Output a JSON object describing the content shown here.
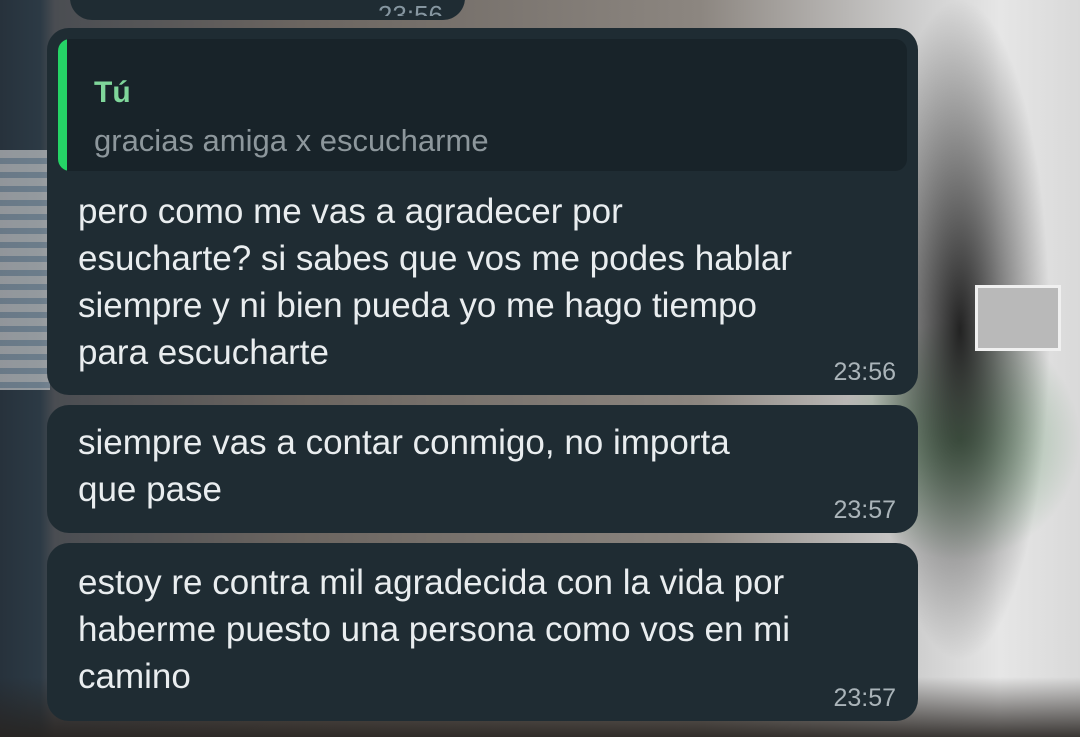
{
  "conversation": {
    "previous_message": {
      "time": "23:56"
    },
    "messages": [
      {
        "quote": {
          "author": "Tú",
          "text": "gracias amiga x escucharme"
        },
        "text": "pero como me vas a agradecer por\nesucharte? si sabes que vos me podes hablar\nsiempre y ni bien pueda yo me hago tiempo\npara escucharte",
        "time": "23:56"
      },
      {
        "text": "siempre vas a contar conmigo, no importa\nque pase",
        "time": "23:57"
      },
      {
        "text": "estoy re contra mil agradecida con la vida por\nhaberme puesto una persona como vos en mi\ncamino",
        "time": "23:57"
      }
    ]
  },
  "colors": {
    "bubble": "#1f2c33",
    "quote_background": "#182329",
    "quote_bar": "#25d366",
    "quote_author": "#7fd69a",
    "text": "#e9edef",
    "timestamp": "#aab4b9"
  }
}
